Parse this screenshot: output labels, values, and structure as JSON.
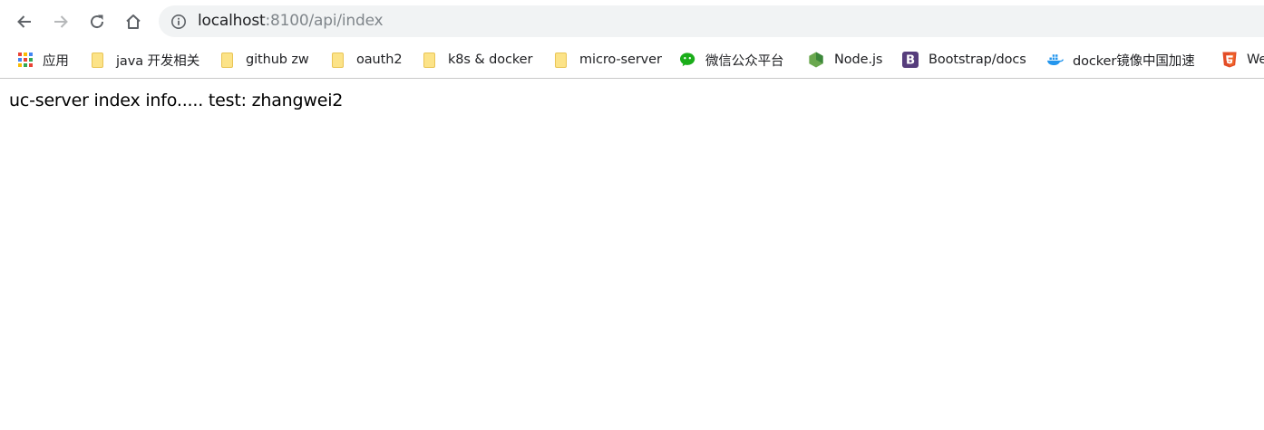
{
  "toolbar": {
    "back_icon": "arrow-left-icon",
    "forward_icon": "arrow-right-icon",
    "reload_icon": "reload-icon",
    "home_icon": "home-icon",
    "info_icon": "info-icon",
    "url_host": "localhost",
    "url_rest": ":8100/api/index"
  },
  "bookmarks": [
    {
      "label": "应用",
      "icon": "apps-grid-icon"
    },
    {
      "label": "java 开发相关",
      "icon": "folder-icon"
    },
    {
      "label": "github zw",
      "icon": "folder-icon"
    },
    {
      "label": "oauth2",
      "icon": "folder-icon"
    },
    {
      "label": "k8s & docker",
      "icon": "folder-icon"
    },
    {
      "label": "micro-server",
      "icon": "folder-icon"
    },
    {
      "label": "微信公众平台",
      "icon": "wechat-icon"
    },
    {
      "label": "Node.js",
      "icon": "nodejs-icon"
    },
    {
      "label": "Bootstrap/docs",
      "icon": "bootstrap-icon"
    },
    {
      "label": "docker镜像中国加速",
      "icon": "docker-icon"
    },
    {
      "label": "We",
      "icon": "html5-icon"
    }
  ],
  "page": {
    "text": "uc-server index info..... test: zhangwei2"
  },
  "colors": {
    "omnibox_bg": "#f1f3f4",
    "folder": "#fce388",
    "wechat": "#1aad19",
    "nodejs": "#6aa84f",
    "bootstrap": "#563d7c",
    "docker": "#2496ed",
    "html5": "#e34c26"
  }
}
